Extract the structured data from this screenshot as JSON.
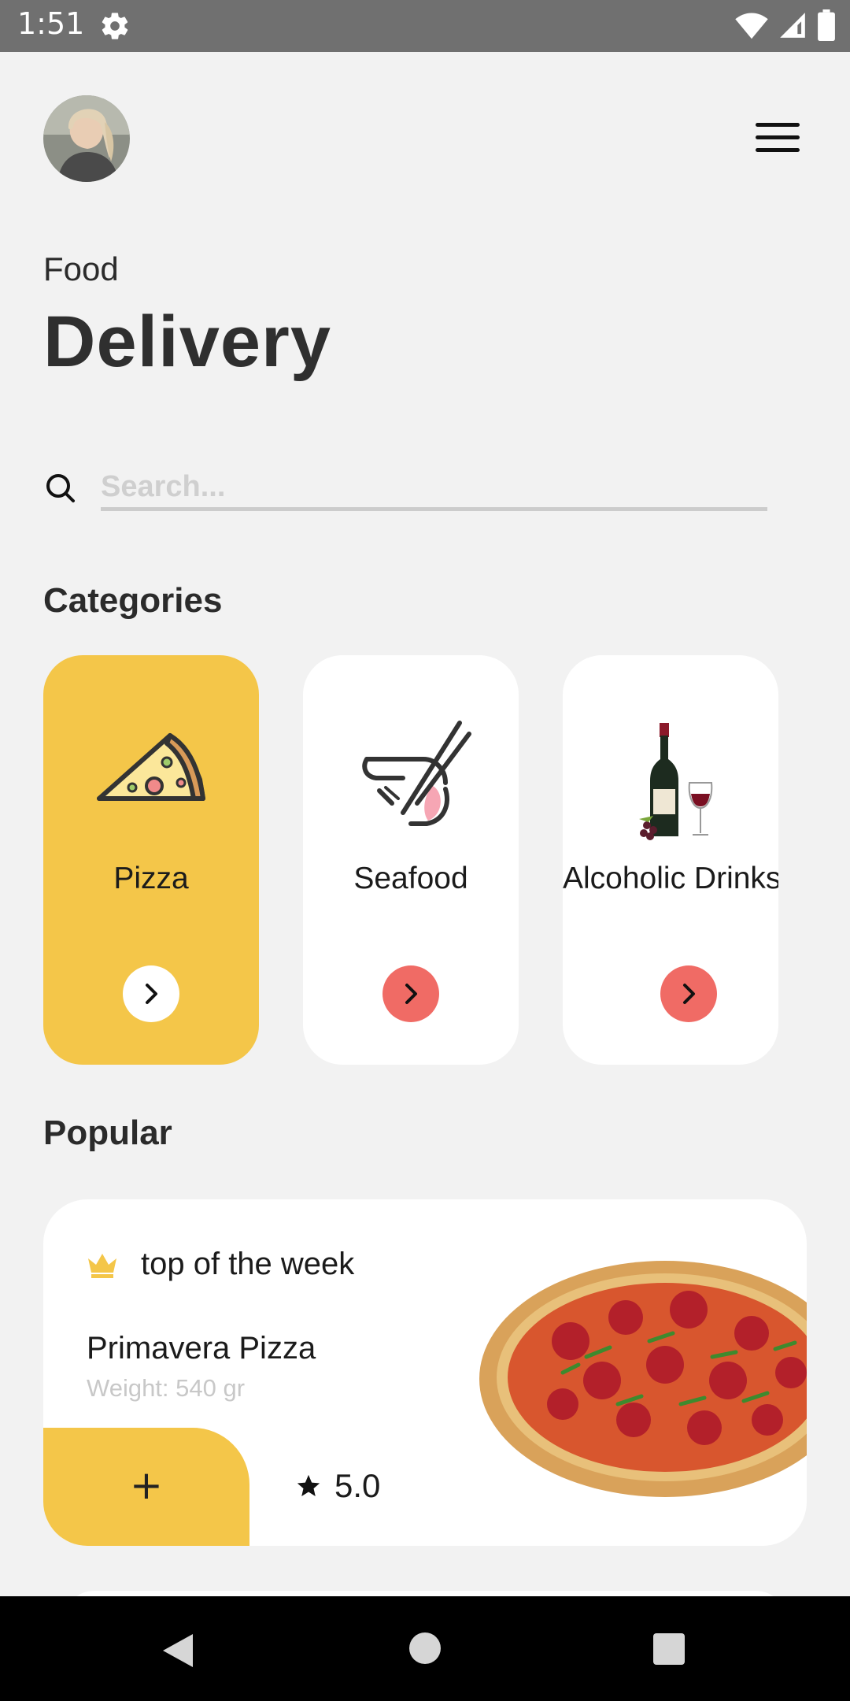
{
  "status_bar": {
    "time": "1:51",
    "gear_icon": "gear-icon",
    "wifi_icon": "wifi-icon",
    "signal_icon": "signal-icon",
    "battery_icon": "battery-icon"
  },
  "header": {
    "avatar": "avatar",
    "menu_icon": "hamburger-menu-icon"
  },
  "title": {
    "small": "Food",
    "big": "Delivery"
  },
  "search": {
    "placeholder": "Search...",
    "icon": "search-icon"
  },
  "categories": {
    "title": "Categories",
    "items": [
      {
        "label": "Pizza",
        "icon": "pizza-icon",
        "active": true
      },
      {
        "label": "Seafood",
        "icon": "shrimp-icon",
        "active": false
      },
      {
        "label": "Alcoholic Drinks",
        "icon": "wine-icon",
        "active": false
      }
    ]
  },
  "popular": {
    "title": "Popular",
    "card": {
      "tag": "top of the week",
      "name": "Primavera Pizza",
      "weight": "Weight: 540 gr",
      "add_label": "+",
      "rating": "5.0"
    }
  },
  "colors": {
    "accent": "#f4c649",
    "arrow": "#f06b65",
    "background": "#f2f2f2"
  }
}
